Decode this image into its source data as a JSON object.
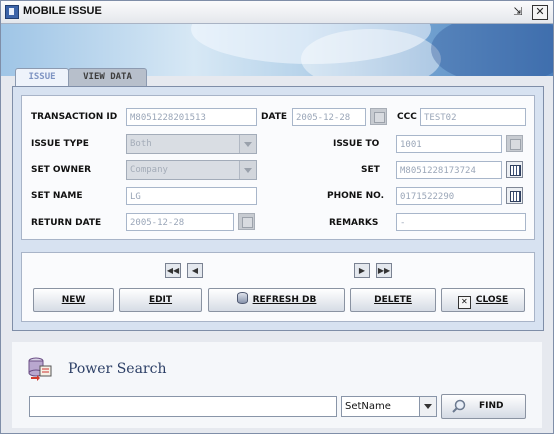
{
  "window": {
    "title": "MOBILE ISSUE",
    "restore_glyph": "⇲",
    "close_glyph": "✕"
  },
  "tabs": [
    {
      "label": "ISSUE",
      "active": true
    },
    {
      "label": "VIEW DATA",
      "active": false
    }
  ],
  "form": {
    "transaction_id": {
      "label": "TRANSACTION ID",
      "value": "M8051228201513"
    },
    "date": {
      "label": "DATE",
      "value": "2005-12-28"
    },
    "ccc": {
      "label": "CCC",
      "value": "TEST02"
    },
    "issue_type": {
      "label": "ISSUE TYPE",
      "value": "Both"
    },
    "issue_to": {
      "label": "ISSUE TO",
      "value": "1001"
    },
    "set_owner": {
      "label": "SET OWNER",
      "value": "Company"
    },
    "set": {
      "label": "SET",
      "value": "M8051228173724"
    },
    "set_name": {
      "label": "SET NAME",
      "value": "LG"
    },
    "phone_no": {
      "label": "PHONE NO.",
      "value": "0171522290"
    },
    "return_date": {
      "label": "RETURN DATE",
      "value": "2005-12-28"
    },
    "remarks": {
      "label": "REMARKS",
      "value": "-"
    }
  },
  "navigation": {
    "first": "◀◀",
    "prev": "◀",
    "next": "▶",
    "last": "▶▶"
  },
  "actions": {
    "new": "NEW",
    "edit": "EDIT",
    "refresh": "REFRESH DB",
    "delete": "DELETE",
    "close": "CLOSE",
    "close_glyph": "✕"
  },
  "search": {
    "title": "Power Search",
    "query": "",
    "field": "SetName",
    "find": "FIND"
  },
  "colors": {
    "panel": "#d7e2f1",
    "field_text": "#9aa6b8",
    "title_text": "#2c3f66"
  }
}
